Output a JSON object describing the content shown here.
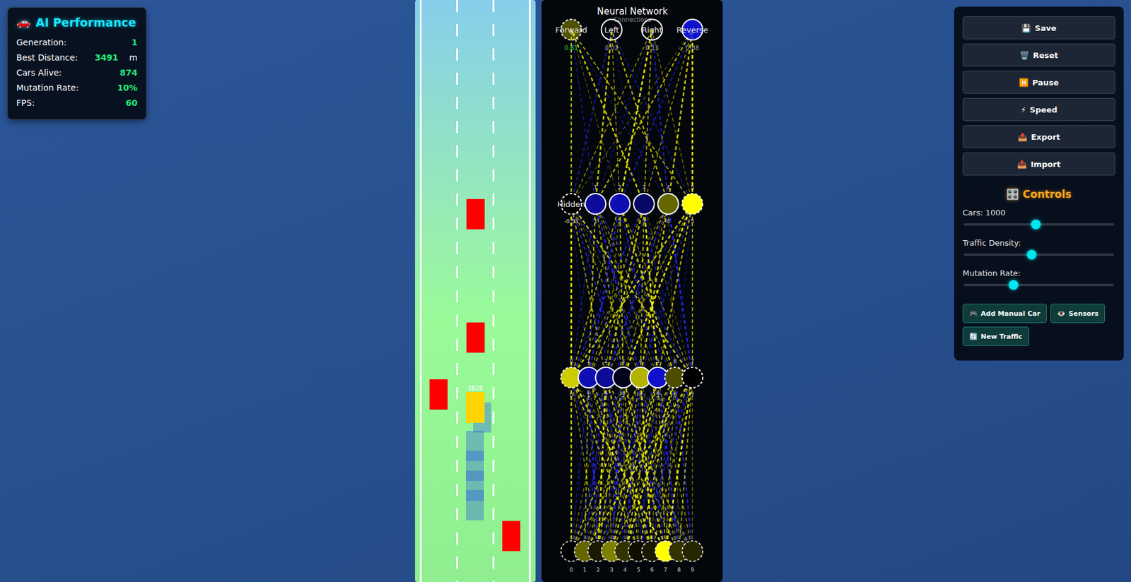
{
  "stats_panel": {
    "icon": "🚗",
    "title": "AI Performance",
    "rows": [
      {
        "label": "Generation:",
        "value": "1",
        "unit": ""
      },
      {
        "label": "Best Distance:",
        "value": "3491",
        "unit": "m"
      },
      {
        "label": "Cars Alive:",
        "value": "874",
        "unit": ""
      },
      {
        "label": "Mutation Rate:",
        "value": "10%",
        "unit": ""
      },
      {
        "label": "FPS:",
        "value": "60",
        "unit": ""
      }
    ]
  },
  "road": {
    "cars": [
      {
        "kind": "traffic",
        "label": ""
      },
      {
        "kind": "traffic",
        "label": ""
      },
      {
        "kind": "traffic",
        "label": ""
      },
      {
        "kind": "traffic",
        "label": ""
      },
      {
        "kind": "ghost",
        "label": ""
      },
      {
        "kind": "ghost",
        "label": ""
      },
      {
        "kind": "ghost",
        "label": ""
      },
      {
        "kind": "ghost",
        "label": ""
      },
      {
        "kind": "ghost",
        "label": ""
      },
      {
        "kind": "best",
        "label": "3828"
      }
    ]
  },
  "network": {
    "title": "Neural Network",
    "subtitle": "Connections",
    "outputs": [
      {
        "name": "Forward",
        "value": "0.61",
        "active": true,
        "activation": 0.3,
        "dashed": true
      },
      {
        "name": "Left",
        "value": "0.02",
        "active": false,
        "activation": 0.0,
        "dashed": false
      },
      {
        "name": "Right",
        "value": "0.13",
        "active": false,
        "activation": 0.0,
        "dashed": false
      },
      {
        "name": "Reverse",
        "value": "0.88",
        "active": false,
        "activation": -0.8,
        "dashed": false
      }
    ],
    "hidden2": [
      {
        "label_top": "Hidden",
        "label_bottom": "-0.53",
        "activation": 0.0,
        "dashed": true
      },
      {
        "label_top": "1",
        "label_bottom": "1",
        "activation": -0.6,
        "dashed": false
      },
      {
        "label_top": "2",
        "label_bottom": "2",
        "activation": -0.7,
        "dashed": false
      },
      {
        "label_top": "3",
        "label_bottom": "3",
        "activation": -0.4,
        "dashed": false
      },
      {
        "label_top": "4",
        "label_bottom": "4",
        "activation": 0.4,
        "dashed": false
      },
      {
        "label_top": "5",
        "label_bottom": "5",
        "activation": 1.0,
        "dashed": true
      }
    ],
    "hidden1": [
      {
        "label_top": "0",
        "label_bottom": "0",
        "activation": 0.8,
        "dashed": true
      },
      {
        "label_top": "1",
        "label_bottom": "1",
        "activation": -0.7,
        "dashed": false
      },
      {
        "label_top": "2",
        "label_bottom": "2",
        "activation": -0.6,
        "dashed": false
      },
      {
        "label_top": "3",
        "label_bottom": "3",
        "activation": -0.1,
        "dashed": false
      },
      {
        "label_top": "4",
        "label_bottom": "4",
        "activation": 0.7,
        "dashed": false
      },
      {
        "label_top": "5",
        "label_bottom": "5",
        "activation": -0.8,
        "dashed": false
      },
      {
        "label_top": "6",
        "label_bottom": "6",
        "activation": 0.3,
        "dashed": true
      },
      {
        "label_top": "7",
        "label_bottom": "7",
        "activation": 0.0,
        "dashed": true
      }
    ],
    "inputs": [
      {
        "label_bottom": "0",
        "activation": 0.0,
        "dashed": true
      },
      {
        "label_bottom": "1",
        "activation": 0.4,
        "dashed": true
      },
      {
        "label_bottom": "2",
        "activation": 0.1,
        "dashed": true
      },
      {
        "label_bottom": "3",
        "activation": 0.5,
        "dashed": true
      },
      {
        "label_bottom": "4",
        "activation": 0.2,
        "dashed": true
      },
      {
        "label_bottom": "5",
        "activation": 0.05,
        "dashed": true
      },
      {
        "label_bottom": "6",
        "activation": 0.1,
        "dashed": true
      },
      {
        "label_bottom": "7",
        "activation": 1.0,
        "dashed": true
      },
      {
        "label_bottom": "8",
        "activation": 0.2,
        "dashed": true
      },
      {
        "label_bottom": "9",
        "activation": 0.15,
        "dashed": true
      }
    ],
    "weights_in_h1": [
      [
        0.8,
        -0.3,
        0.5,
        -0.6,
        0.2,
        0.7,
        -0.4,
        0.9,
        -0.2,
        0.4
      ],
      [
        -0.5,
        0.6,
        -0.8,
        0.3,
        -0.2,
        0.5,
        0.7,
        -0.4,
        0.6,
        -0.7
      ],
      [
        0.4,
        -0.7,
        0.9,
        0.5,
        -0.6,
        -0.3,
        0.8,
        0.2,
        -0.5,
        0.6
      ],
      [
        -0.6,
        0.3,
        0.7,
        -0.9,
        0.4,
        0.6,
        -0.2,
        0.8,
        0.5,
        -0.3
      ],
      [
        0.7,
        0.5,
        -0.4,
        0.6,
        -0.8,
        0.3,
        0.9,
        -0.6,
        0.4,
        0.2
      ],
      [
        -0.3,
        -0.6,
        0.5,
        0.8,
        0.7,
        -0.5,
        0.4,
        0.6,
        -0.9,
        0.5
      ],
      [
        0.6,
        0.4,
        -0.5,
        -0.3,
        0.9,
        0.7,
        -0.6,
        0.5,
        0.3,
        -0.8
      ],
      [
        -0.2,
        0.8,
        0.3,
        0.6,
        -0.5,
        -0.7,
        0.5,
        0.9,
        0.6,
        0.4
      ]
    ],
    "weights_h1_h2": [
      [
        0.9,
        -0.4,
        0.6,
        -0.7,
        0.5,
        0.3,
        -0.6,
        0.8
      ],
      [
        -0.5,
        0.7,
        -0.3,
        0.6,
        -0.8,
        0.4,
        0.5,
        -0.6
      ],
      [
        0.6,
        -0.8,
        0.4,
        0.7,
        -0.3,
        -0.6,
        0.8,
        0.5
      ],
      [
        -0.7,
        0.5,
        0.8,
        -0.4,
        0.6,
        0.9,
        -0.5,
        0.3
      ],
      [
        0.4,
        0.6,
        -0.7,
        0.5,
        0.8,
        -0.4,
        0.3,
        -0.9
      ],
      [
        0.8,
        -0.3,
        0.5,
        0.9,
        -0.6,
        0.7,
        -0.4,
        0.6
      ]
    ],
    "weights_h2_out": [
      [
        0.7,
        -0.5,
        0.3,
        0.8,
        -0.4,
        0.6
      ],
      [
        -0.6,
        0.8,
        0.5,
        -0.3,
        0.7,
        -0.5
      ],
      [
        0.5,
        -0.4,
        0.9,
        0.6,
        -0.7,
        0.4
      ],
      [
        0.3,
        0.7,
        -0.6,
        0.5,
        0.8,
        0.9
      ]
    ]
  },
  "controls_panel": {
    "buttons": [
      {
        "icon": "💾",
        "label": "Save"
      },
      {
        "icon": "🗑️",
        "label": "Reset"
      },
      {
        "icon": "⏸️",
        "label": "Pause"
      },
      {
        "icon": "⚡",
        "label": "Speed"
      },
      {
        "icon": "📤",
        "label": "Export"
      },
      {
        "icon": "📥",
        "label": "Import"
      }
    ],
    "title_icon": "🎛️",
    "title": "Controls",
    "sliders": [
      {
        "label": "Cars: 1000",
        "level": 0.48
      },
      {
        "label": "Traffic Density:",
        "level": 0.45
      },
      {
        "label": "Mutation Rate:",
        "level": 0.33
      }
    ],
    "toggles": [
      {
        "icon": "🎮",
        "label": "Add Manual Car"
      },
      {
        "icon": "👁️",
        "label": "Sensors"
      },
      {
        "icon": "🔄",
        "label": "New Traffic"
      }
    ]
  }
}
